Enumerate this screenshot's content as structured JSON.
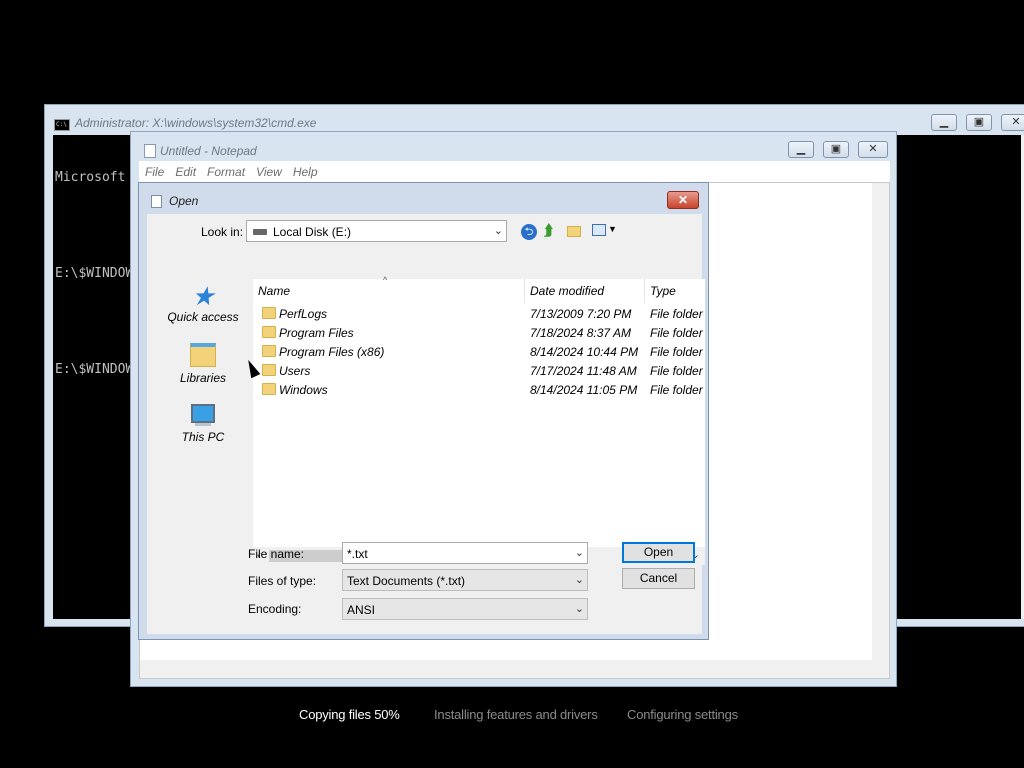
{
  "cmd": {
    "title": "Administrator: X:\\windows\\system32\\cmd.exe",
    "icon_text": "C:\\",
    "lines": [
      "Microsoft",
      "",
      "E:\\$WINDOW",
      "",
      "E:\\$WINDOW"
    ]
  },
  "notepad": {
    "title": "Untitled - Notepad",
    "menu": [
      "File",
      "Edit",
      "Format",
      "View",
      "Help"
    ]
  },
  "dialog": {
    "title": "Open",
    "close_label": "✕",
    "look_in_label": "Look in:",
    "look_in_value": "Local Disk (E:)",
    "places": [
      {
        "label": "Quick access",
        "icon": "star-icon"
      },
      {
        "label": "Libraries",
        "icon": "libraries-icon"
      },
      {
        "label": "This PC",
        "icon": "computer-icon"
      }
    ],
    "columns": {
      "name": "Name",
      "date": "Date modified",
      "type": "Type"
    },
    "files": [
      {
        "name": "PerfLogs",
        "date": "7/13/2009 7:20 PM",
        "type": "File folder"
      },
      {
        "name": "Program Files",
        "date": "7/18/2024 8:37 AM",
        "type": "File folder"
      },
      {
        "name": "Program Files (x86)",
        "date": "8/14/2024 10:44 PM",
        "type": "File folder"
      },
      {
        "name": "Users",
        "date": "7/17/2024 11:48 AM",
        "type": "File folder"
      },
      {
        "name": "Windows",
        "date": "8/14/2024 11:05 PM",
        "type": "File folder"
      }
    ],
    "file_name_label": "File name:",
    "file_name_value": "*.txt",
    "files_of_type_label": "Files of type:",
    "files_of_type_value": "Text Documents (*.txt)",
    "encoding_label": "Encoding:",
    "encoding_value": "ANSI",
    "open_label": "Open",
    "cancel_label": "Cancel"
  },
  "setup": {
    "steps": [
      "Copying files 50%",
      "Installing features and drivers",
      "Configuring settings"
    ],
    "active_color": "#ffffff",
    "inactive_color": "#8a8a8a"
  }
}
